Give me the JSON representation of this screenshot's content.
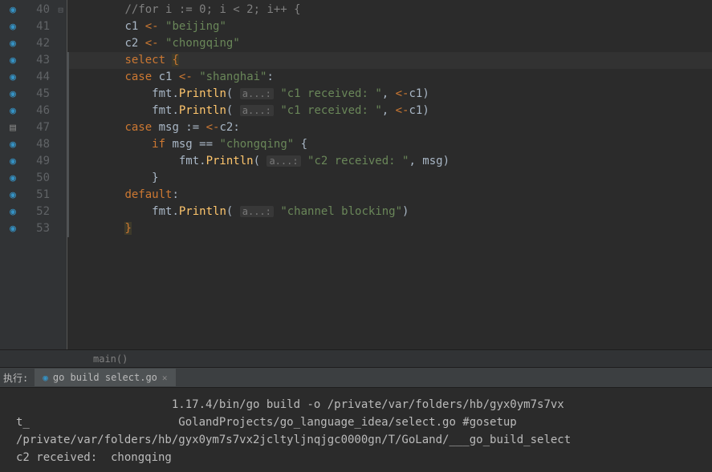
{
  "gutter_icons": [
    "bp",
    "bp",
    "bp",
    "bp",
    "bp",
    "bp",
    "bp",
    "doc",
    "bp",
    "bp",
    "bp",
    "bp",
    "bp",
    "bp"
  ],
  "lines": [
    {
      "num": 40,
      "fold": "⊟",
      "tokens": [
        {
          "cls": "tok-comment",
          "txt": "//for i := 0; i < 2; i++ {"
        }
      ],
      "indent": "        "
    },
    {
      "num": 41,
      "tokens": [
        {
          "cls": "tok-ident",
          "txt": "c1 "
        },
        {
          "cls": "tok-keyword",
          "txt": "<-"
        },
        {
          "cls": "tok-ident",
          "txt": " "
        },
        {
          "cls": "tok-string",
          "txt": "\"beijing\""
        }
      ],
      "indent": "        "
    },
    {
      "num": 42,
      "tokens": [
        {
          "cls": "tok-ident",
          "txt": "c2 "
        },
        {
          "cls": "tok-keyword",
          "txt": "<-"
        },
        {
          "cls": "tok-ident",
          "txt": " "
        },
        {
          "cls": "tok-string",
          "txt": "\"chongqing\""
        }
      ],
      "indent": "        "
    },
    {
      "num": 43,
      "current": true,
      "vline": true,
      "tokens": [
        {
          "cls": "tok-keyword",
          "txt": "select "
        },
        {
          "cls": "tok-hl-brace",
          "txt": "{"
        }
      ],
      "indent": "        "
    },
    {
      "num": 44,
      "vline": true,
      "tokens": [
        {
          "cls": "tok-keyword",
          "txt": "case "
        },
        {
          "cls": "tok-ident",
          "txt": "c1 "
        },
        {
          "cls": "tok-keyword",
          "txt": "<-"
        },
        {
          "cls": "tok-ident",
          "txt": " "
        },
        {
          "cls": "tok-string",
          "txt": "\"shanghai\""
        },
        {
          "cls": "tok-ident",
          "txt": ":"
        }
      ],
      "indent": "        "
    },
    {
      "num": 45,
      "vline": true,
      "tokens": [
        {
          "cls": "tok-ident",
          "txt": "fmt."
        },
        {
          "cls": "tok-func",
          "txt": "Println"
        },
        {
          "cls": "tok-brace",
          "txt": "( "
        },
        {
          "cls": "tok-hint",
          "txt": "a...:"
        },
        {
          "cls": "tok-ident",
          "txt": " "
        },
        {
          "cls": "tok-string",
          "txt": "\"c1 received: \""
        },
        {
          "cls": "tok-ident",
          "txt": ", "
        },
        {
          "cls": "tok-keyword",
          "txt": "<-"
        },
        {
          "cls": "tok-ident",
          "txt": "c1"
        },
        {
          "cls": "tok-brace",
          "txt": ")"
        }
      ],
      "indent": "            "
    },
    {
      "num": 46,
      "vline": true,
      "tokens": [
        {
          "cls": "tok-ident",
          "txt": "fmt."
        },
        {
          "cls": "tok-func",
          "txt": "Println"
        },
        {
          "cls": "tok-brace",
          "txt": "( "
        },
        {
          "cls": "tok-hint",
          "txt": "a...:"
        },
        {
          "cls": "tok-ident",
          "txt": " "
        },
        {
          "cls": "tok-string",
          "txt": "\"c1 received: \""
        },
        {
          "cls": "tok-ident",
          "txt": ", "
        },
        {
          "cls": "tok-keyword",
          "txt": "<-"
        },
        {
          "cls": "tok-ident",
          "txt": "c1"
        },
        {
          "cls": "tok-brace",
          "txt": ")"
        }
      ],
      "indent": "            "
    },
    {
      "num": 47,
      "vline": true,
      "tokens": [
        {
          "cls": "tok-keyword",
          "txt": "case "
        },
        {
          "cls": "tok-ident",
          "txt": "msg := "
        },
        {
          "cls": "tok-keyword",
          "txt": "<-"
        },
        {
          "cls": "tok-ident",
          "txt": "c2:"
        }
      ],
      "indent": "        "
    },
    {
      "num": 48,
      "vline": true,
      "tokens": [
        {
          "cls": "tok-keyword",
          "txt": "if "
        },
        {
          "cls": "tok-ident",
          "txt": "msg == "
        },
        {
          "cls": "tok-string",
          "txt": "\"chongqing\""
        },
        {
          "cls": "tok-ident",
          "txt": " {"
        }
      ],
      "indent": "            "
    },
    {
      "num": 49,
      "vline": true,
      "tokens": [
        {
          "cls": "tok-ident",
          "txt": "fmt."
        },
        {
          "cls": "tok-func",
          "txt": "Println"
        },
        {
          "cls": "tok-brace",
          "txt": "( "
        },
        {
          "cls": "tok-hint",
          "txt": "a...:"
        },
        {
          "cls": "tok-ident",
          "txt": " "
        },
        {
          "cls": "tok-string",
          "txt": "\"c2 received: \""
        },
        {
          "cls": "tok-ident",
          "txt": ", msg"
        },
        {
          "cls": "tok-brace",
          "txt": ")"
        }
      ],
      "indent": "                "
    },
    {
      "num": 50,
      "vline": true,
      "tokens": [
        {
          "cls": "tok-ident",
          "txt": "}"
        }
      ],
      "indent": "            "
    },
    {
      "num": 51,
      "vline": true,
      "tokens": [
        {
          "cls": "tok-keyword",
          "txt": "default"
        },
        {
          "cls": "tok-ident",
          "txt": ":"
        }
      ],
      "indent": "        "
    },
    {
      "num": 52,
      "vline": true,
      "tokens": [
        {
          "cls": "tok-ident",
          "txt": "fmt."
        },
        {
          "cls": "tok-func",
          "txt": "Println"
        },
        {
          "cls": "tok-brace",
          "txt": "( "
        },
        {
          "cls": "tok-hint",
          "txt": "a...:"
        },
        {
          "cls": "tok-ident",
          "txt": " "
        },
        {
          "cls": "tok-string",
          "txt": "\"channel blocking\""
        },
        {
          "cls": "tok-brace",
          "txt": ")"
        }
      ],
      "indent": "            "
    },
    {
      "num": 53,
      "vline": true,
      "tokens": [
        {
          "cls": "tok-hl-brace",
          "txt": "}"
        }
      ],
      "indent": "        "
    }
  ],
  "breadcrumb": "main()",
  "terminal": {
    "run_label": "执行:",
    "tab_icon": "●",
    "tab_label": "go build select.go",
    "lines": [
      "                       1.17.4/bin/go build -o /private/var/folders/hb/gyx0ym7s7vx",
      "t_                      GolandProjects/go_language_idea/select.go #gosetup",
      "/private/var/folders/hb/gyx0ym7s7vx2jcltyljnqjgc0000gn/T/GoLand/___go_build_select",
      "c2 received:  chongqing"
    ]
  }
}
